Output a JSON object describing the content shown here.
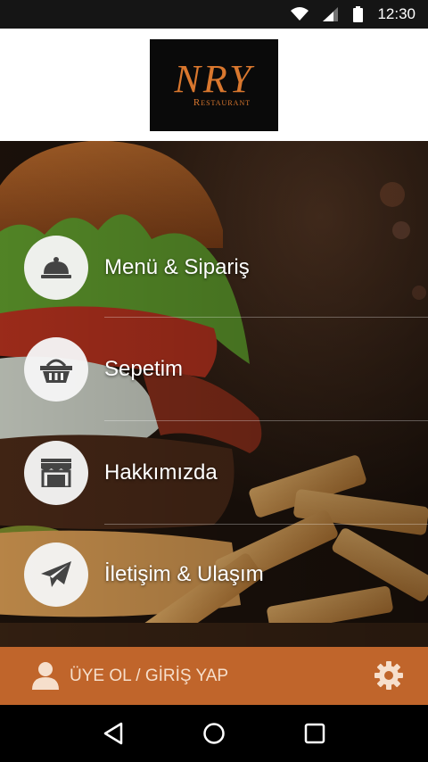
{
  "status_bar": {
    "time": "12:30",
    "icons": [
      "wifi-icon",
      "signal-icon",
      "battery-icon"
    ]
  },
  "header": {
    "logo_text": "NRY",
    "logo_subtext": "Restaurant"
  },
  "menu": {
    "items": [
      {
        "label": "Menü & Sipariş",
        "icon": "cloche-icon"
      },
      {
        "label": "Sepetim",
        "icon": "basket-icon"
      },
      {
        "label": "Hakkımızda",
        "icon": "storefront-icon"
      },
      {
        "label": "İletişim & Ulaşım",
        "icon": "paper-plane-icon"
      }
    ]
  },
  "member_bar": {
    "label": "ÜYE OL / GİRİŞ YAP",
    "icons": [
      "user-icon",
      "gear-icon"
    ]
  },
  "colors": {
    "accent": "#c0652b",
    "logo": "#d9772e",
    "header_bg": "#ffffff",
    "nav_bg": "#000000"
  },
  "nav_bar": {
    "buttons": [
      "back-icon",
      "home-icon",
      "recents-icon"
    ]
  }
}
